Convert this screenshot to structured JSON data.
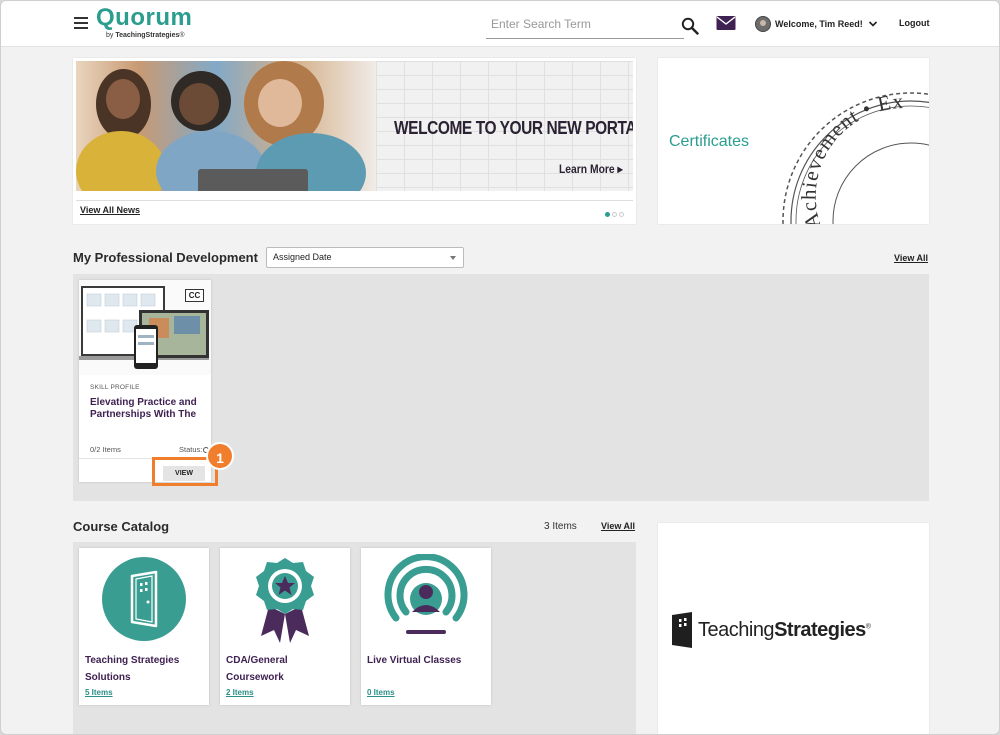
{
  "header": {
    "logo_main": "Quorum",
    "logo_sub_prefix": "by ",
    "logo_sub_brand": "TeachingStrategies",
    "logo_sub_mark": "®",
    "search_placeholder": "Enter Search Term",
    "user_label": "Welcome, Tim Reed!",
    "logout_label": "Logout"
  },
  "news": {
    "banner_title": "WELCOME TO YOUR NEW PORTAL",
    "banner_cta": "Learn More ▸",
    "view_all_label": "View All News",
    "carousel_total": 3,
    "carousel_active": 1
  },
  "certificates": {
    "title": "Certificates",
    "seal_text": "Achievement • Ex"
  },
  "pd": {
    "title": "My Professional Development",
    "sort_value": "Assigned Date",
    "view_all_label": "View All",
    "card": {
      "cc_label": "CC",
      "kicker": "SKILL PROFILE",
      "name": "Elevating Practice and Partnerships With The",
      "items": "0/2 Items",
      "status_label": "Status:",
      "view_label": "VIEW"
    },
    "callout_number": "1"
  },
  "catalog": {
    "title": "Course Catalog",
    "count": "3 Items",
    "view_all_label": "View All",
    "courses": [
      {
        "name": "Teaching Strategies Solutions",
        "link": "5 Items",
        "icon": "door-icon"
      },
      {
        "name": "CDA/General Coursework",
        "link": "2 Items",
        "icon": "award-ribbon-icon"
      },
      {
        "name": "Live Virtual Classes",
        "link": "0 Items",
        "icon": "live-broadcast-icon"
      }
    ]
  },
  "ts_logo": {
    "word_regular": "Teaching",
    "word_bold": "Strategies",
    "mark": "®"
  },
  "colors": {
    "teal": "#2a9d8f",
    "purple": "#3f2152",
    "callout_orange": "#f07e2d"
  }
}
